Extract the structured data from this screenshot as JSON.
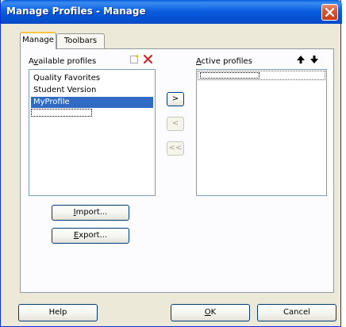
{
  "window": {
    "title": "Manage Profiles - Manage"
  },
  "tabs": [
    {
      "label": "Manage",
      "active": true
    },
    {
      "label": "Toolbars",
      "active": false
    }
  ],
  "available": {
    "label_pre": "A",
    "label_u": "v",
    "label_post": "ailable profiles",
    "items": [
      "Quality Favorites",
      "Student Version",
      "MyProfile"
    ],
    "selected_index": 2,
    "icons": [
      "new-profile-icon",
      "delete-icon"
    ]
  },
  "active": {
    "label_pre": "",
    "label_u": "A",
    "label_post": "ctive profiles",
    "items": [],
    "icons": [
      "move-up-icon",
      "move-down-icon"
    ]
  },
  "transfer_buttons": {
    "add": ">",
    "remove": "<",
    "remove_all": "<<"
  },
  "actions": {
    "import_u": "I",
    "import_rest": "mport...",
    "export_u": "E",
    "export_rest": "xport..."
  },
  "footer": {
    "help": "Help",
    "ok_u": "O",
    "ok_rest": "K",
    "cancel": "Cancel"
  },
  "colors": {
    "title_bar": "#0553d4",
    "selection": "#316ac5",
    "close_button": "#c43d18",
    "dialog_bg": "#ece9d8"
  }
}
